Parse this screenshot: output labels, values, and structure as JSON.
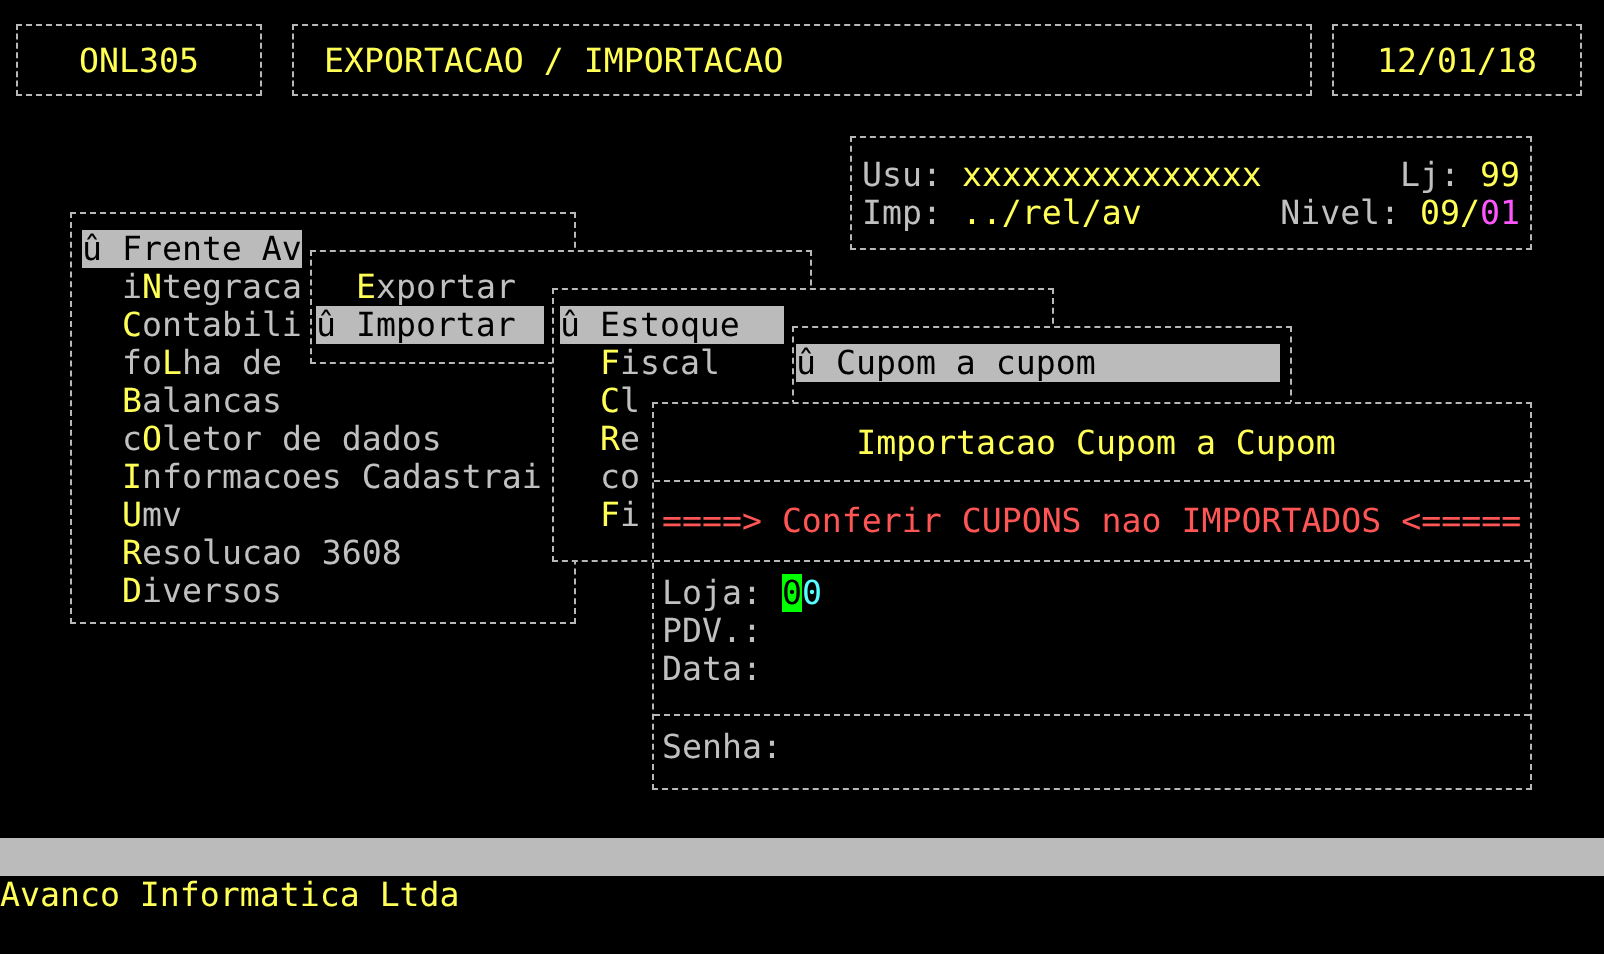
{
  "header": {
    "program_code": "ONL305",
    "title": "EXPORTACAO / IMPORTACAO",
    "date": "12/01/18"
  },
  "session": {
    "user_label": "Usu:",
    "user": "xxxxxxxxxxxxxxx",
    "store_label": "Lj:",
    "store": "99",
    "printer_label": "Imp:",
    "printer": "../rel/av",
    "level_label": "Nivel:",
    "level_main": "09/",
    "level_sub": "01"
  },
  "menus": [
    {
      "items": [
        {
          "pre": "û Frente Av",
          "selected": true
        },
        {
          "pre": "i",
          "key": "N",
          "post": "tegraca",
          "selected": false
        },
        {
          "key": "C",
          "post": "ontabili",
          "selected": false
        },
        {
          "pre": "fo",
          "key": "L",
          "post": "ha de",
          "selected": false
        },
        {
          "key": "B",
          "post": "alancas",
          "selected": false
        },
        {
          "pre": "c",
          "key": "O",
          "post": "letor de dados",
          "selected": false
        },
        {
          "key": "I",
          "post": "nformacoes Cadastrai",
          "selected": false
        },
        {
          "key": "U",
          "post": "mv",
          "selected": false
        },
        {
          "key": "R",
          "post": "esolucao 3608",
          "selected": false
        },
        {
          "key": "D",
          "post": "iversos",
          "selected": false
        }
      ]
    },
    {
      "items": [
        {
          "key": "E",
          "post": "xportar",
          "selected": false
        },
        {
          "pre": "û Importar",
          "selected": true
        }
      ]
    },
    {
      "items": [
        {
          "pre": "û Estoque",
          "selected": true
        },
        {
          "key": "F",
          "post": "iscal",
          "selected": false
        },
        {
          "key": "C",
          "post": "l",
          "selected": false
        },
        {
          "key": "R",
          "post": "e",
          "selected": false
        },
        {
          "post": "co",
          "selected": false
        },
        {
          "key": "F",
          "post": "i",
          "selected": false
        }
      ]
    },
    {
      "items": [
        {
          "pre": "û Cupom a cupom",
          "selected": true
        }
      ]
    }
  ],
  "dialog": {
    "title": "Importacao Cupom a Cupom",
    "warning": "====> Conferir CUPONS nao IMPORTADOS <=====",
    "fields": [
      {
        "label": "Loja:",
        "value": "00",
        "focused": true
      },
      {
        "label": "PDV.:"
      },
      {
        "label": "Data:"
      }
    ],
    "password": {
      "label": "Senha:"
    }
  },
  "footer": {
    "company": "Avanco Informatica Ltda"
  }
}
